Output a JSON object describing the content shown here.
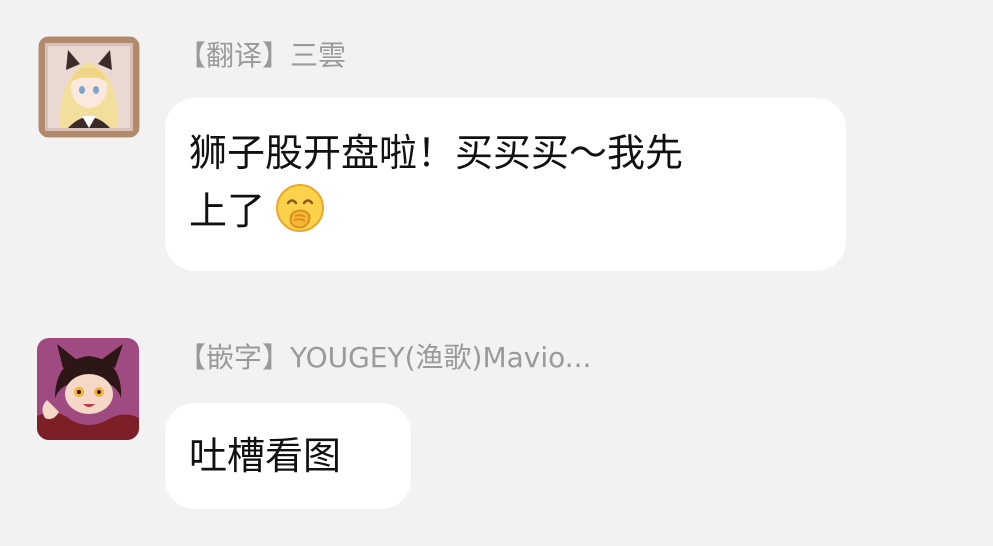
{
  "messages": [
    {
      "sender": "【翻译】三雲",
      "text_line1": "狮子股开盘啦！买买买～我先",
      "text_line2": "上了",
      "emoji": "hand-over-mouth-emoji"
    },
    {
      "sender": "【嵌字】YOUGEY(渔歌)Mavio...",
      "text_line1": "吐槽看图"
    }
  ],
  "colors": {
    "background": "#f2f2f2",
    "bubble": "#ffffff",
    "sender_text": "#9a9a9a",
    "message_text": "#111111"
  }
}
